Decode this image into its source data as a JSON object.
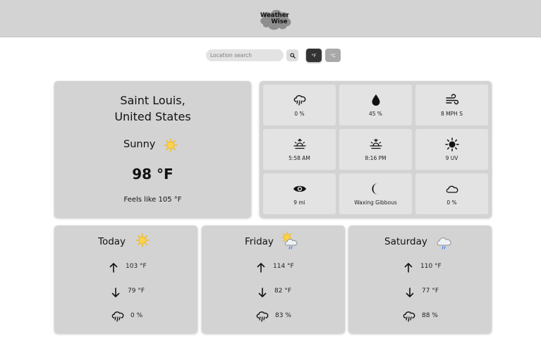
{
  "app": {
    "logo_line1": "Weather",
    "logo_line2": "Wise"
  },
  "search": {
    "placeholder": "Location search",
    "value": "",
    "unit_f": "°F",
    "unit_c": "°C",
    "active_unit": "F"
  },
  "current": {
    "city_line1": "Saint Louis,",
    "city_line2": "United States",
    "condition": "Sunny",
    "condition_icon": "sun-icon",
    "temp": "98 °F",
    "feels_like": "Feels like 105 °F"
  },
  "details": [
    {
      "icon": "rain-icon",
      "value": "0 %"
    },
    {
      "icon": "droplet-icon",
      "value": "45 %"
    },
    {
      "icon": "wind-icon",
      "value": "8 MPH S"
    },
    {
      "icon": "sunrise-icon",
      "value": "5:58 AM"
    },
    {
      "icon": "sunset-icon",
      "value": "8:16 PM"
    },
    {
      "icon": "uv-sun-icon",
      "value": "9 UV"
    },
    {
      "icon": "eye-icon",
      "value": "9 mi"
    },
    {
      "icon": "moon-icon",
      "value": "Waxing Gibbous"
    },
    {
      "icon": "cloud-icon",
      "value": "0 %"
    }
  ],
  "forecast": [
    {
      "day": "Today",
      "icon": "sun-icon",
      "high": "103 °F",
      "low": "79 °F",
      "rain": "0 %"
    },
    {
      "day": "Friday",
      "icon": "sun-cloud-rain-icon",
      "high": "114 °F",
      "low": "82 °F",
      "rain": "83 %"
    },
    {
      "day": "Saturday",
      "icon": "cloud-rain-icon",
      "high": "110 °F",
      "low": "77 °F",
      "rain": "88 %"
    }
  ],
  "colors": {
    "header_bg": "#d3d3d3",
    "card_bg": "#d3d3d3",
    "tile_bg": "#e3e3e3",
    "active_unit_bg": "#333333",
    "inactive_unit_bg": "#a9a9a9",
    "sun": "#f5b800"
  }
}
